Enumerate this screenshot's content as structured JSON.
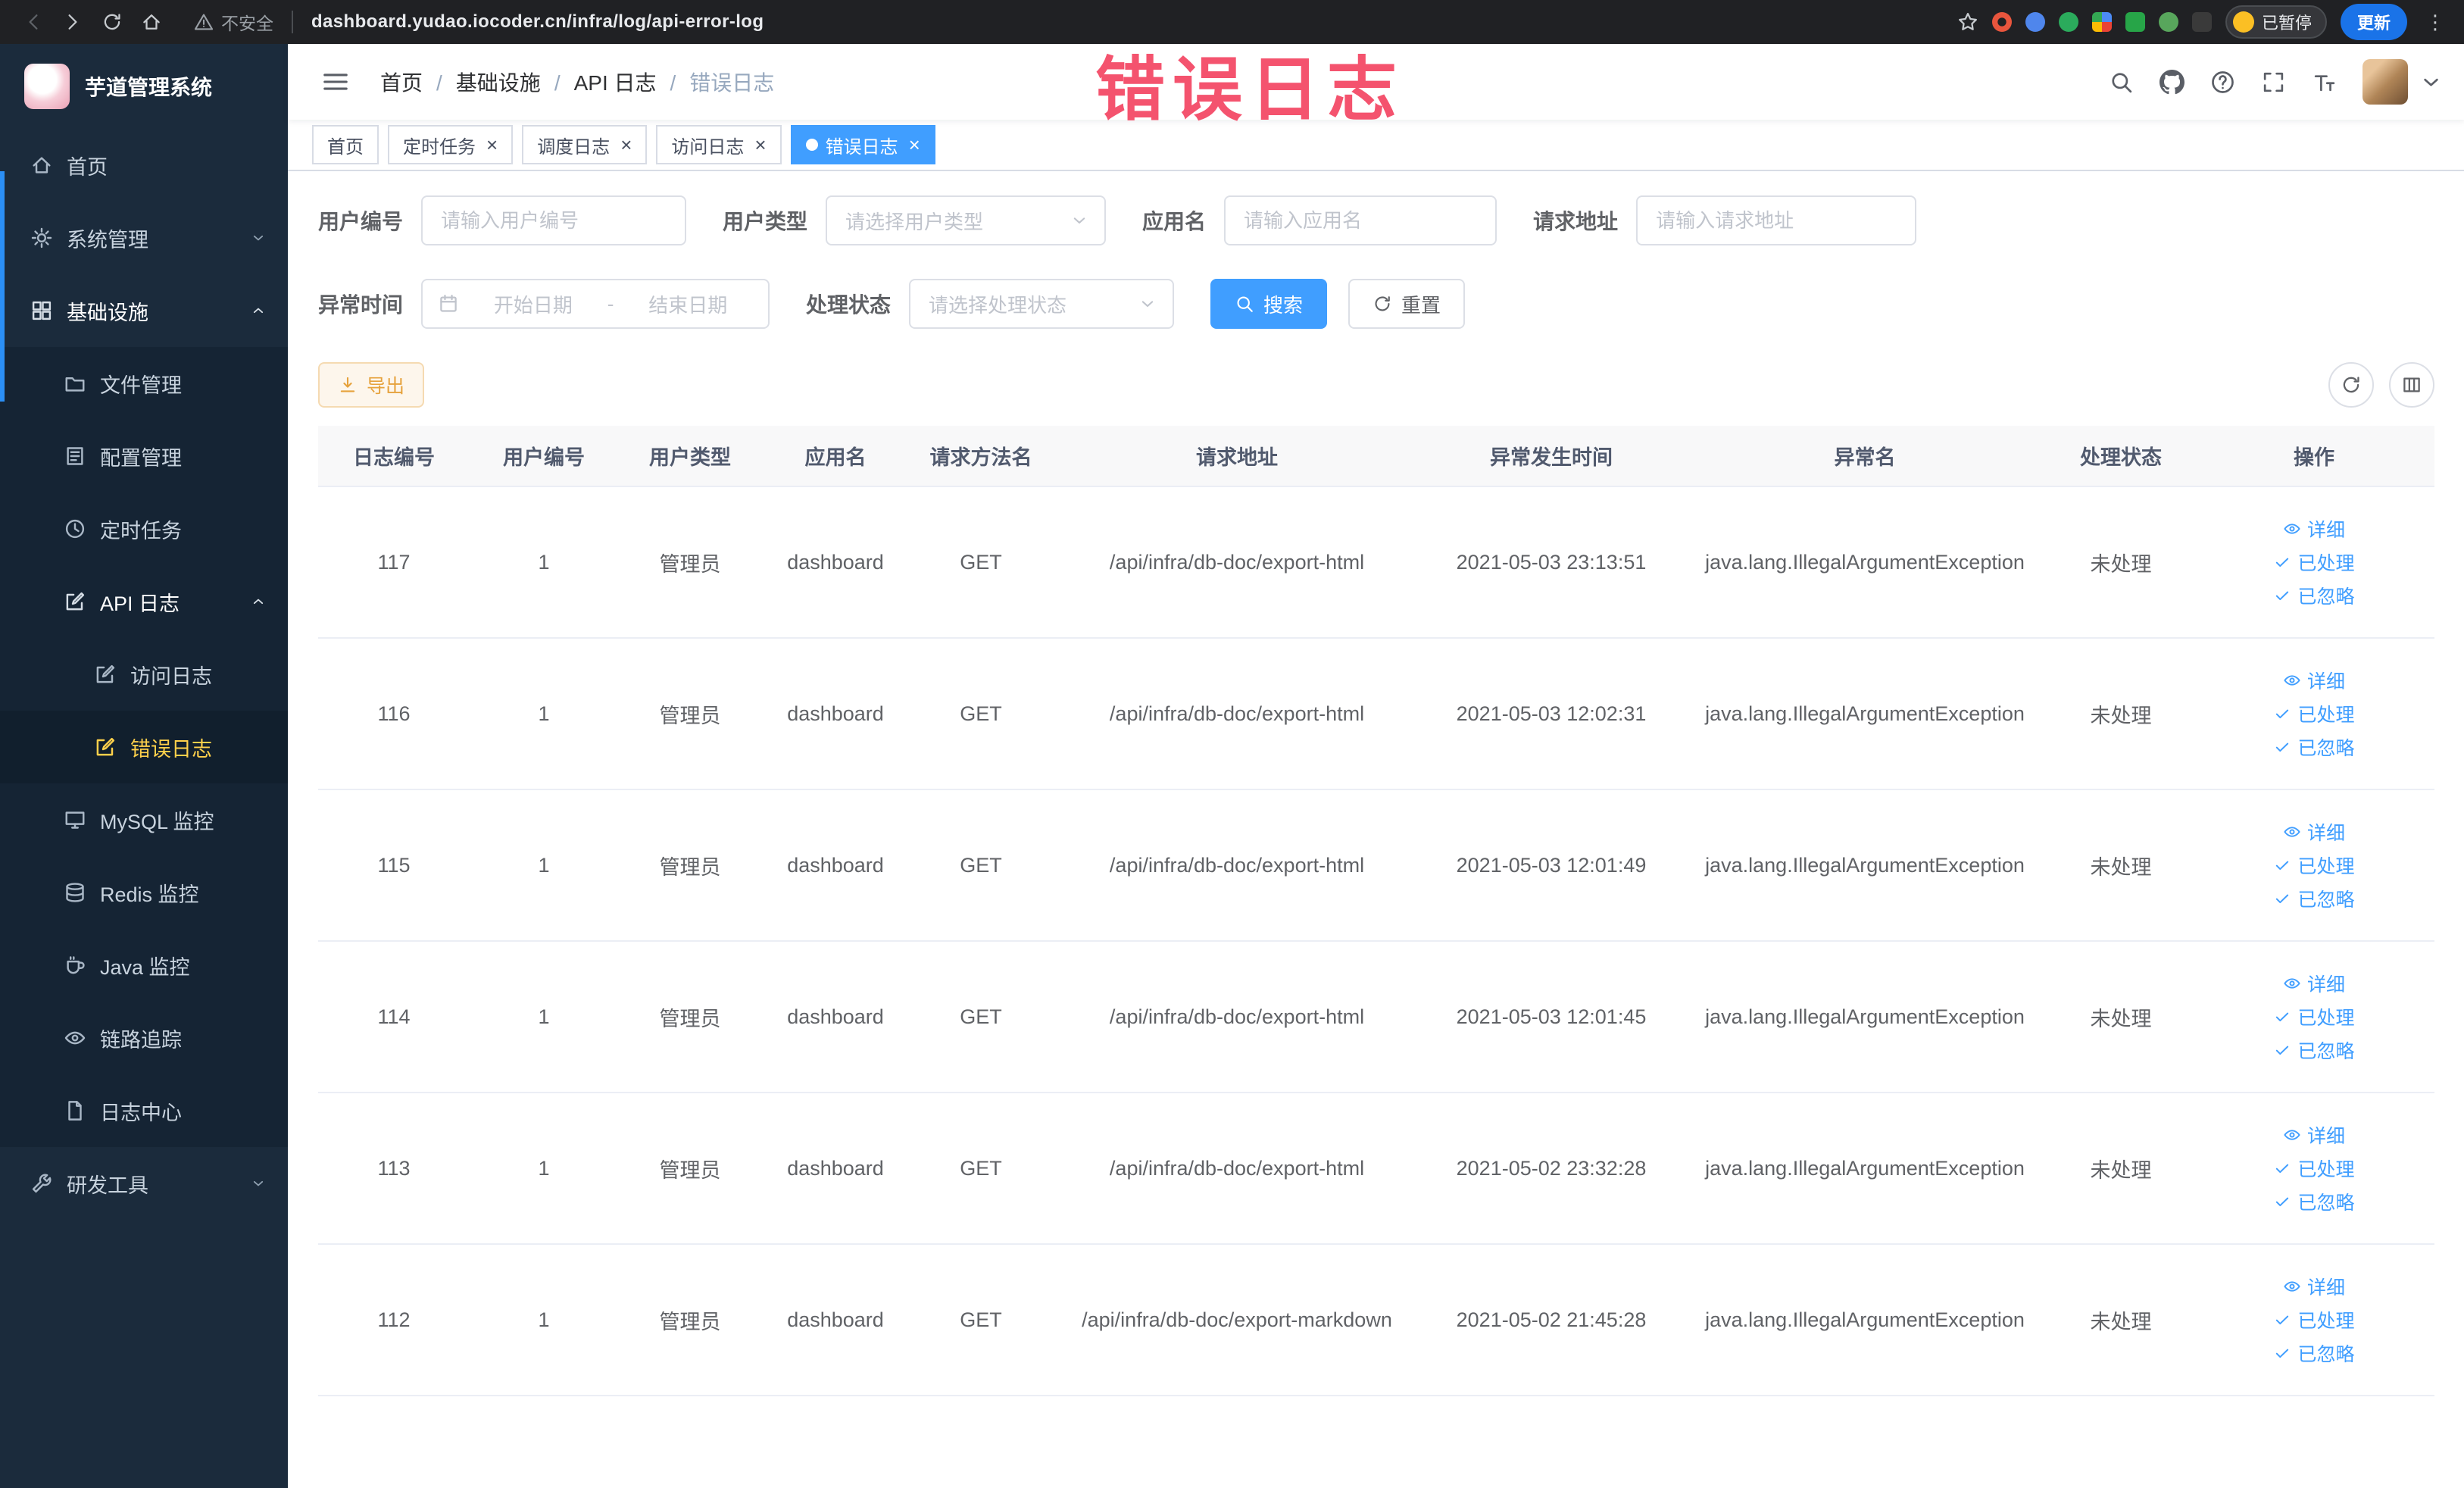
{
  "browser": {
    "security_label": "不安全",
    "url": "dashboard.yudao.iocoder.cn/infra/log/api-error-log",
    "paused_button": "已暂停",
    "update_button": "更新"
  },
  "watermark": "错误日志",
  "sidebar": {
    "logo_title": "芋道管理系统",
    "items": [
      {
        "label": "首页"
      },
      {
        "label": "系统管理"
      },
      {
        "label": "基础设施"
      },
      {
        "label": "文件管理"
      },
      {
        "label": "配置管理"
      },
      {
        "label": "定时任务"
      },
      {
        "label": "API 日志"
      },
      {
        "label": "访问日志"
      },
      {
        "label": "错误日志"
      },
      {
        "label": "MySQL 监控"
      },
      {
        "label": "Redis 监控"
      },
      {
        "label": "Java 监控"
      },
      {
        "label": "链路追踪"
      },
      {
        "label": "日志中心"
      },
      {
        "label": "研发工具"
      }
    ]
  },
  "header": {
    "breadcrumb": [
      "首页",
      "基础设施",
      "API 日志",
      "错误日志"
    ]
  },
  "tabs": [
    {
      "label": "首页"
    },
    {
      "label": "定时任务"
    },
    {
      "label": "调度日志"
    },
    {
      "label": "访问日志"
    },
    {
      "label": "错误日志"
    }
  ],
  "filters": {
    "user_id_label": "用户编号",
    "user_id_placeholder": "请输入用户编号",
    "user_type_label": "用户类型",
    "user_type_placeholder": "请选择用户类型",
    "app_name_label": "应用名",
    "app_name_placeholder": "请输入应用名",
    "request_url_label": "请求地址",
    "request_url_placeholder": "请输入请求地址",
    "time_label": "异常时间",
    "time_start_placeholder": "开始日期",
    "time_separator": "-",
    "time_end_placeholder": "结束日期",
    "status_label": "处理状态",
    "status_placeholder": "请选择处理状态",
    "search_label": "搜索",
    "reset_label": "重置"
  },
  "toolbar": {
    "export_label": "导出"
  },
  "table": {
    "columns": [
      "日志编号",
      "用户编号",
      "用户类型",
      "应用名",
      "请求方法名",
      "请求地址",
      "异常发生时间",
      "异常名",
      "处理状态",
      "操作"
    ],
    "actions": {
      "detail": "详细",
      "processed": "已处理",
      "ignore": "已忽略"
    },
    "rows": [
      {
        "log_id": "117",
        "user_id": "1",
        "user_type": "管理员",
        "app_name": "dashboard",
        "method": "GET",
        "request_url": "/api/infra/db-doc/export-html",
        "time": "2021-05-03 23:13:51",
        "exception": "java.lang.IllegalArgumentException",
        "status": "未处理"
      },
      {
        "log_id": "116",
        "user_id": "1",
        "user_type": "管理员",
        "app_name": "dashboard",
        "method": "GET",
        "request_url": "/api/infra/db-doc/export-html",
        "time": "2021-05-03 12:02:31",
        "exception": "java.lang.IllegalArgumentException",
        "status": "未处理"
      },
      {
        "log_id": "115",
        "user_id": "1",
        "user_type": "管理员",
        "app_name": "dashboard",
        "method": "GET",
        "request_url": "/api/infra/db-doc/export-html",
        "time": "2021-05-03 12:01:49",
        "exception": "java.lang.IllegalArgumentException",
        "status": "未处理"
      },
      {
        "log_id": "114",
        "user_id": "1",
        "user_type": "管理员",
        "app_name": "dashboard",
        "method": "GET",
        "request_url": "/api/infra/db-doc/export-html",
        "time": "2021-05-03 12:01:45",
        "exception": "java.lang.IllegalArgumentException",
        "status": "未处理"
      },
      {
        "log_id": "113",
        "user_id": "1",
        "user_type": "管理员",
        "app_name": "dashboard",
        "method": "GET",
        "request_url": "/api/infra/db-doc/export-html",
        "time": "2021-05-02 23:32:28",
        "exception": "java.lang.IllegalArgumentException",
        "status": "未处理"
      },
      {
        "log_id": "112",
        "user_id": "1",
        "user_type": "管理员",
        "app_name": "dashboard",
        "method": "GET",
        "request_url": "/api/infra/db-doc/export-markdown",
        "time": "2021-05-02 21:45:28",
        "exception": "java.lang.IllegalArgumentException",
        "status": "未处理"
      }
    ]
  },
  "colors": {
    "primary": "#409eff",
    "sidebar_bg": "#1b2b3c",
    "sidebar_active_text": "#ffd04b",
    "export_text": "#e6a23c",
    "watermark": "#f4536e",
    "update_button_bg": "#1a73e8"
  }
}
